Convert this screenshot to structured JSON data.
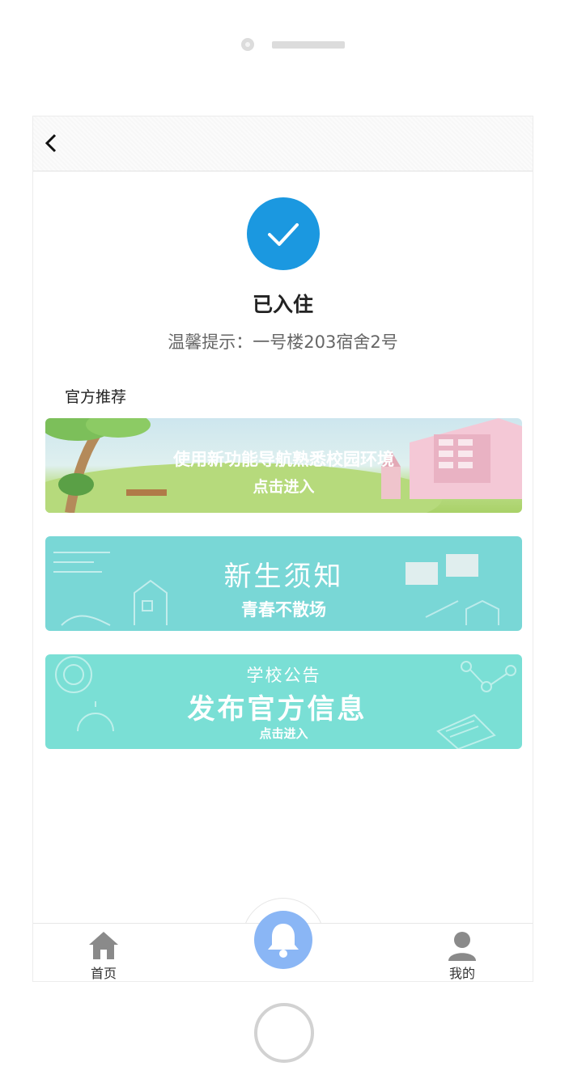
{
  "status": {
    "title": "已入住",
    "tip": "温馨提示：一号楼203宿舍2号"
  },
  "section": {
    "title": "官方推荐"
  },
  "banners": [
    {
      "line1": "使用新功能导航熟悉校园环境",
      "line2": "点击进入"
    },
    {
      "line1": "新生须知",
      "line2": "青春不散场"
    },
    {
      "line1": "学校公告",
      "line2": "发布官方信息",
      "line3": "点击进入"
    }
  ],
  "tabbar": {
    "home_label": "首页",
    "mine_label": "我的"
  },
  "colors": {
    "accent": "#1b98e0",
    "center_button": "#8ab6f5",
    "banner2": "#79d7d6",
    "banner3": "#7adfd5"
  }
}
